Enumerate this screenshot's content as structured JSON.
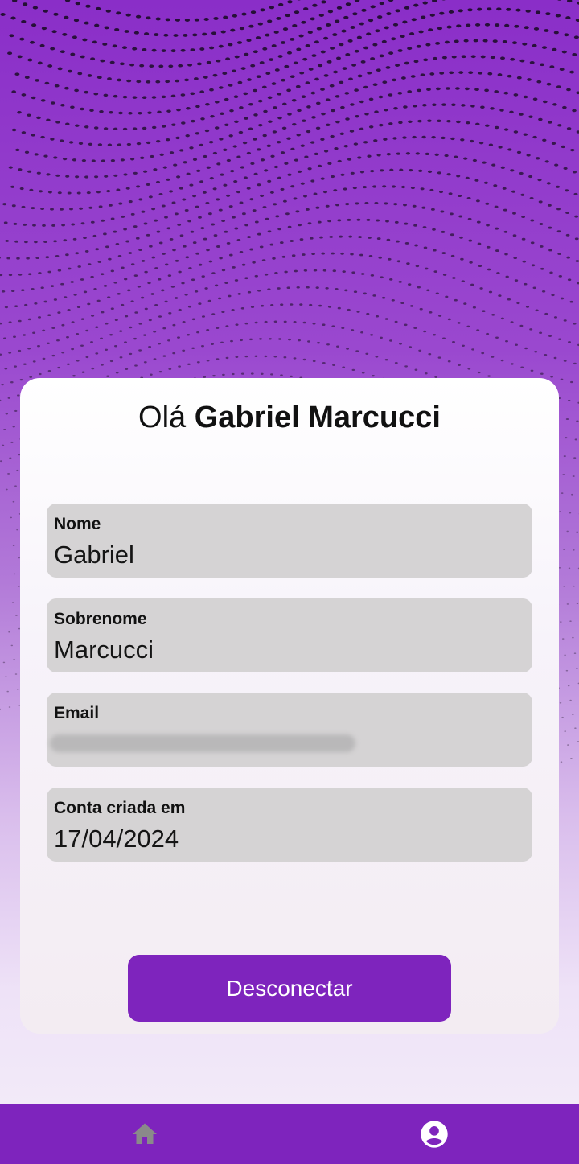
{
  "greeting": {
    "prefix": "Olá",
    "name": "Gabriel Marcucci"
  },
  "fields": [
    {
      "label": "Nome",
      "value": "Gabriel"
    },
    {
      "label": "Sobrenome",
      "value": "Marcucci"
    },
    {
      "label": "Email",
      "value": ""
    },
    {
      "label": "Conta criada em",
      "value": "17/04/2024"
    }
  ],
  "logout_button": {
    "label": "Desconectar"
  },
  "navbar": {
    "items": [
      {
        "icon": "home-icon",
        "active": false
      },
      {
        "icon": "account-circle-icon",
        "active": true
      }
    ]
  },
  "colors": {
    "primary": "#7e24bd",
    "field_bg": "#d5d3d4",
    "nav_inactive": "#8a8a8a",
    "nav_active": "#ffffff"
  }
}
